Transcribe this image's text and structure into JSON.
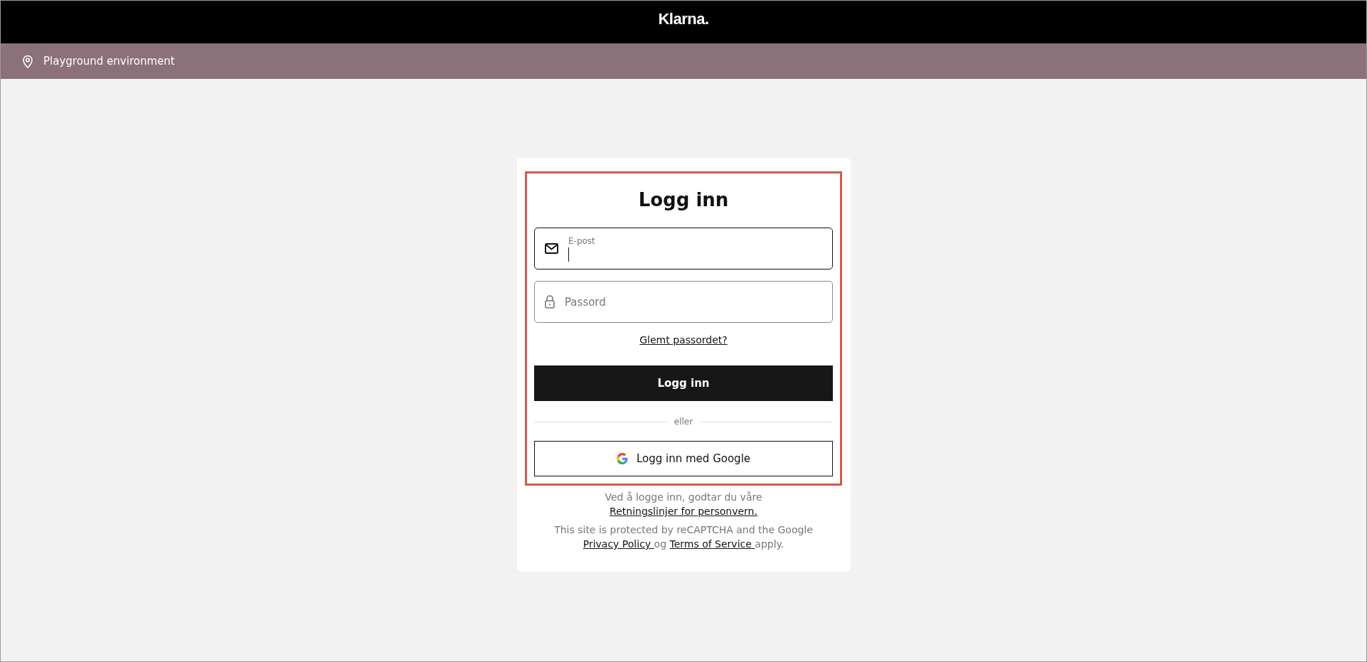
{
  "header": {
    "logo": "Klarna."
  },
  "environment_bar": {
    "label": "Playground environment"
  },
  "login_card": {
    "highlighted": true,
    "title": "Logg inn",
    "fields": [
      {
        "kind": "email",
        "label": "E-post",
        "focused": true
      },
      {
        "kind": "password",
        "placeholder": "Passord",
        "focused": false
      }
    ],
    "forgot_link": "Glemt passordet?",
    "submit_button": "Logg inn",
    "divider": "eller",
    "google_button": "Logg inn med Google"
  },
  "footer": [
    [
      {
        "kind": "text",
        "text": "Ved å logge inn, godtar du våre "
      },
      {
        "kind": "link",
        "text": "Retningslinjer for personvern."
      }
    ],
    [
      {
        "kind": "text",
        "text": "This site is protected by reCAPTCHA and the Google "
      },
      {
        "kind": "link",
        "text": "Privacy Policy "
      },
      {
        "kind": "text",
        "text": "og "
      },
      {
        "kind": "link",
        "text": "Terms of Service "
      },
      {
        "kind": "text",
        "text": "apply."
      }
    ]
  ]
}
